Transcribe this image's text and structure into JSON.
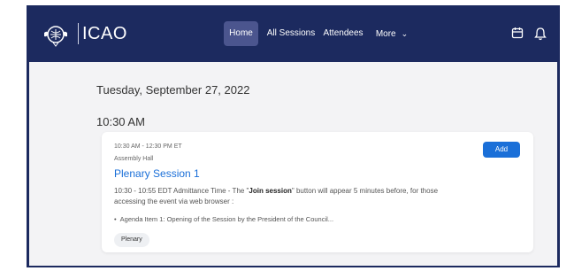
{
  "header": {
    "logo_text": "ICAO",
    "nav": {
      "home": "Home",
      "all_sessions": "All Sessions",
      "attendees": "Attendees",
      "more": "More"
    }
  },
  "agenda": {
    "date": "Tuesday, September 27, 2022",
    "time_slot": "10:30 AM",
    "session": {
      "time_range": "10:30 AM - 12:30 PM ET",
      "room": "Assembly Hall",
      "title": "Plenary Session 1",
      "add_label": "Add",
      "desc_before": "10:30 - 10:55 EDT Admittance Time - The \"",
      "desc_bold": "Join session",
      "desc_after": "\" button will appear 5 minutes before, for those accessing the event via web browser :",
      "bullet": "Agenda Item 1: Opening of the Session by the President of the Council...",
      "tag": "Plenary"
    }
  },
  "colors": {
    "nav_bg": "#1c2a5f",
    "accent": "#1a6fd8"
  },
  "icons": [
    "icao-emblem-icon",
    "chevron-down-icon",
    "calendar-icon",
    "bell-icon"
  ]
}
